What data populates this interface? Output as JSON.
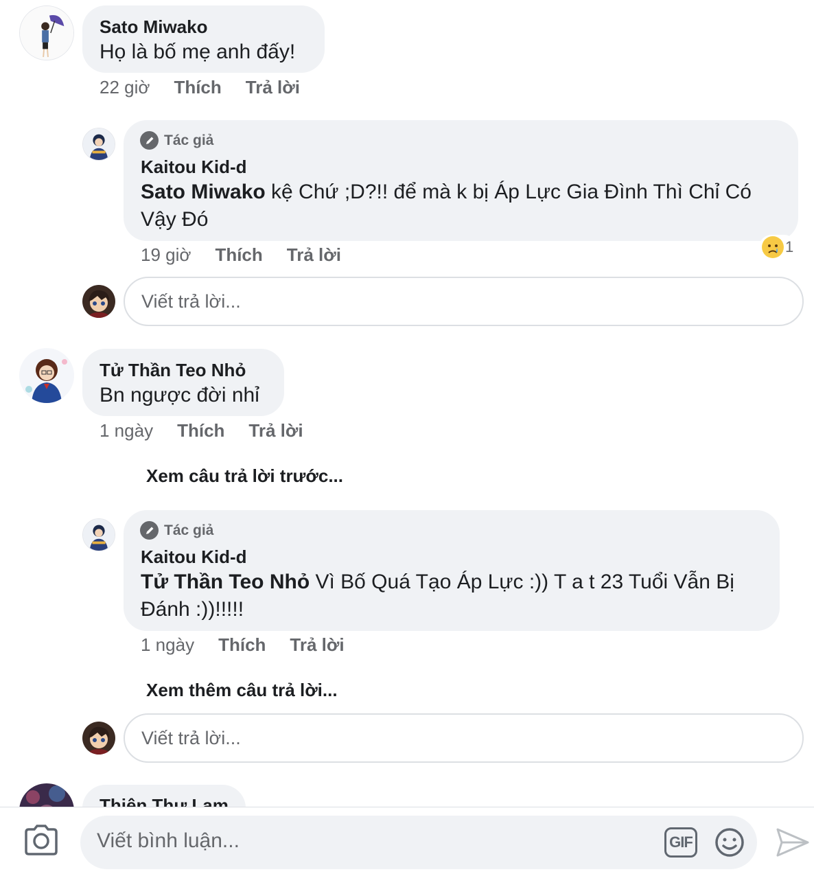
{
  "comments": [
    {
      "name": "Sato Miwako",
      "text": "Họ là bố mẹ anh đấy!",
      "time": "22 giờ",
      "like": "Thích",
      "reply": "Trả lời"
    },
    {
      "badge": "Tác giả",
      "name": "Kaitou Kid-d",
      "mention": "Sato Miwako",
      "text_line1": " kệ Chứ ;D?!! để mà k bị Áp Lực Gia Đình Thì Chỉ Có",
      "text_line2": "Vậy Đó",
      "time": "19 giờ",
      "like": "Thích",
      "reply": "Trả lời",
      "reaction_count": "1"
    },
    {
      "name": "Tử Thần Teo Nhỏ",
      "text": "Bn ngược đời nhỉ",
      "time": "1 ngày",
      "like": "Thích",
      "reply": "Trả lời"
    },
    {
      "badge": "Tác giả",
      "name": "Kaitou Kid-d",
      "mention": "Tử Thần Teo Nhỏ",
      "text_line1": " Vì Bố Quá Tạo Áp Lực :)) T a t 23 Tuổi Vẫn Bị",
      "text_line2": "Đánh :))!!!!!",
      "time": "1 ngày",
      "like": "Thích",
      "reply": "Trả lời"
    },
    {
      "name": "Thiên Thư Lam"
    }
  ],
  "reply_placeholder": "Viết trả lời...",
  "view_previous": "Xem câu trả lời trước...",
  "view_more": "Xem thêm câu trả lời...",
  "composer": {
    "placeholder": "Viết bình luận...",
    "gif_label": "GIF"
  },
  "colors": {
    "bubble": "#f0f2f5",
    "secondary_text": "#65676b",
    "primary_text": "#1c1e21"
  },
  "icons": [
    "camera-icon",
    "gif-icon",
    "emoji-icon",
    "send-icon",
    "pencil-icon",
    "sad-reaction-icon"
  ]
}
